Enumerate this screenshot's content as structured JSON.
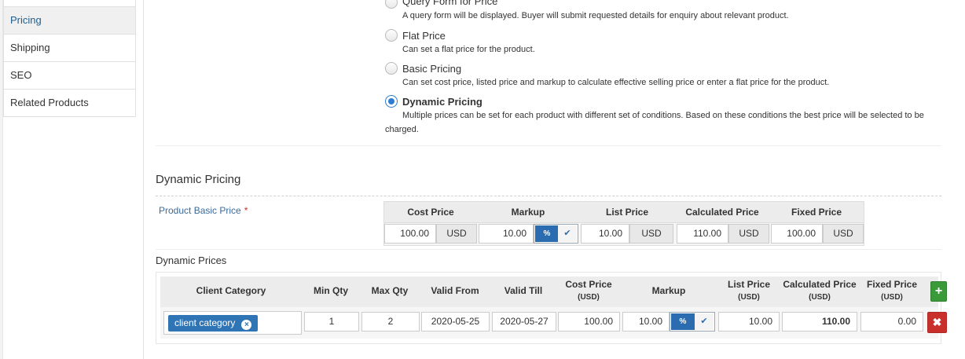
{
  "sidebar": {
    "items": [
      {
        "label": "Pricing",
        "active": true
      },
      {
        "label": "Shipping",
        "active": false
      },
      {
        "label": "SEO",
        "active": false
      },
      {
        "label": "Related Products",
        "active": false
      }
    ]
  },
  "pricing_options": [
    {
      "label": "Query Form for Price",
      "desc": "A query form will be displayed. Buyer will submit requested details for enquiry about relevant product.",
      "checked": false
    },
    {
      "label": "Flat Price",
      "desc": "Can set a flat price for the product.",
      "checked": false
    },
    {
      "label": "Basic Pricing",
      "desc": "Can set cost price, listed price and markup to calculate effective selling price or enter a flat price for the product.",
      "checked": false
    },
    {
      "label": "Dynamic Pricing",
      "desc": "Multiple prices can be set for each product with different set of conditions. Based on these conditions the best price will be selected to be charged.",
      "checked": true
    }
  ],
  "dynamic_pricing": {
    "title": "Dynamic Pricing",
    "basic_price_label": "Product Basic Price",
    "required_mark": "*",
    "headers": {
      "cost_price": "Cost Price",
      "markup": "Markup",
      "list_price": "List Price",
      "calculated_price": "Calculated Price",
      "fixed_price": "Fixed Price"
    },
    "values": {
      "cost_price": "100.00",
      "cost_currency": "USD",
      "markup": "10.00",
      "markup_unit": "%",
      "markup_check": "✔",
      "list_price": "10.00",
      "list_currency": "USD",
      "calculated_price": "110.00",
      "calculated_currency": "USD",
      "fixed_price": "100.00",
      "fixed_currency": "USD"
    }
  },
  "dynamic_prices": {
    "label": "Dynamic Prices",
    "columns": {
      "client_category": "Client Category",
      "min_qty": "Min Qty",
      "max_qty": "Max Qty",
      "valid_from": "Valid From",
      "valid_till": "Valid Till",
      "cost_price": "Cost Price",
      "cost_price_unit": "(USD)",
      "markup": "Markup",
      "list_price": "List Price",
      "list_price_unit": "(USD)",
      "calculated_price": "Calculated Price",
      "calculated_price_unit": "(USD)",
      "fixed_price": "Fixed Price",
      "fixed_price_unit": "(USD)"
    },
    "rows": [
      {
        "client_category": "client category",
        "remove_chip": "×",
        "min_qty": "1",
        "max_qty": "2",
        "valid_from": "2020-05-25",
        "valid_till": "2020-05-27",
        "cost_price": "100.00",
        "markup": "10.00",
        "markup_unit": "%",
        "markup_check": "✔",
        "list_price": "10.00",
        "calculated_price": "110.00",
        "fixed_price": "0.00",
        "delete_icon": "✖"
      }
    ],
    "add_icon": "+"
  },
  "colors": {
    "accent": "#2b6cb0",
    "add": "#3a9a3a",
    "delete": "#c9302c",
    "link": "#3a6a9a"
  }
}
